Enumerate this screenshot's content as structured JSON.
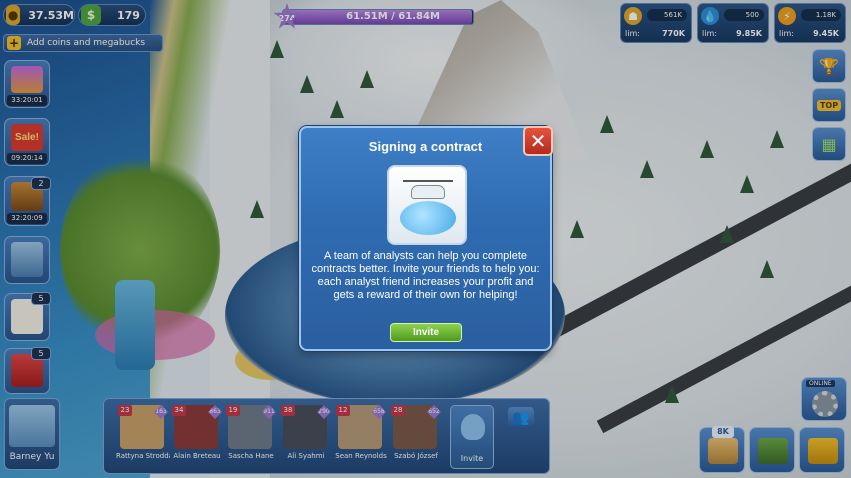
{
  "hud": {
    "coins": "37.53M",
    "megabucks": "179",
    "add_coins_label": "Add coins and megabucks",
    "level": "274",
    "xp_text": "61.51M / 61.84M",
    "xp_progress": 0.995
  },
  "resources": [
    {
      "icon": "population-icon",
      "current": "561K",
      "lim_label": "lim:",
      "limit": "770K"
    },
    {
      "icon": "water-icon",
      "current": "500",
      "lim_label": "lim:",
      "limit": "9.85K"
    },
    {
      "icon": "electricity-icon",
      "current": "1.18K",
      "lim_label": "lim:",
      "limit": "9.45K"
    }
  ],
  "left_panel": {
    "timers": [
      "33:20:01",
      "09:20:14",
      "32:20:09"
    ],
    "chest_badge": "2",
    "sale_label": "Sale!",
    "contracts_badge": "5",
    "gifts_badge": "5"
  },
  "dialog": {
    "title": "Signing a contract",
    "close_label": "✕",
    "body": "A team of analysts can help you complete contracts better. Invite your friends to help you: each analyst friend increases your profit and gets a reward of their own for helping!",
    "invite_label": "Invite"
  },
  "me": {
    "name": "Barney Yu"
  },
  "friends": [
    {
      "level": "23",
      "badge": "163",
      "name": "Rattyna Stroddar",
      "color": "#c9a26b"
    },
    {
      "level": "34",
      "badge": "863",
      "name": "Alain Breteau",
      "color": "#8b3b3b"
    },
    {
      "level": "19",
      "badge": "911",
      "name": "Sascha Hane",
      "color": "#6f7c8a"
    },
    {
      "level": "38",
      "badge": "290",
      "name": "Ali Syahmi",
      "color": "#4a4f5c"
    },
    {
      "level": "12",
      "badge": "658",
      "name": "Sean Reynolds",
      "color": "#b59a7a"
    },
    {
      "level": "28",
      "badge": "652",
      "name": "Szabó József",
      "color": "#7b5a4a"
    }
  ],
  "friends_invite_label": "Invite",
  "bottom_right": {
    "warehouse_badge": "8K",
    "online_label": "ONLINE"
  },
  "right_panel": {
    "top_label": "TOP"
  }
}
